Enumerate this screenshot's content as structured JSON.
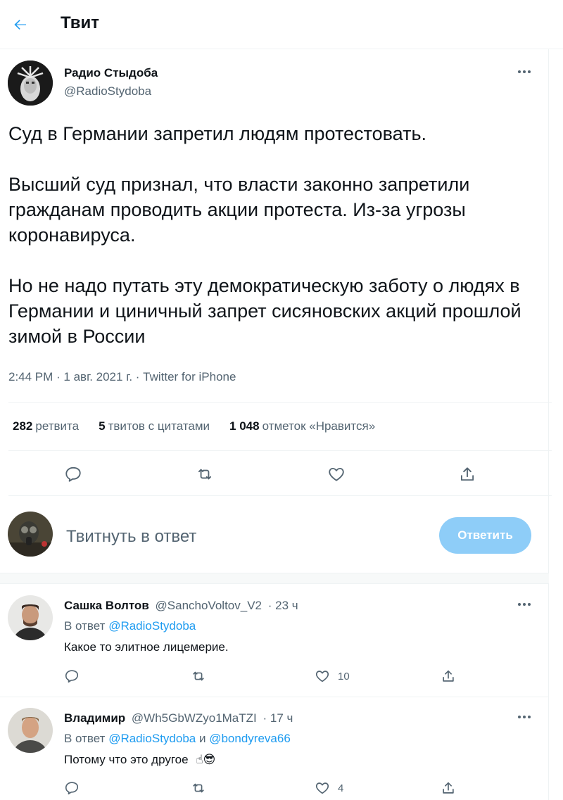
{
  "header": {
    "title": "Твит"
  },
  "tweet": {
    "author_name": "Радио Стыдоба",
    "author_handle": "@RadioStydoba",
    "paragraphs": [
      "Суд в Германии запретил людям протестовать.",
      "Высший суд признал, что власти законно запретили гражданам проводить акции протеста. Из-за угрозы коронавируса.",
      "Но не надо путать эту демократическую заботу о людях в Германии и циничный запрет сисяновских акций прошлой зимой в России"
    ],
    "meta": "2:44 PM · 1 авг. 2021 г. · Twitter for iPhone",
    "stats": {
      "retweets_count": "282",
      "retweets_label": "ретвита",
      "quotes_count": "5",
      "quotes_label": "твитов с цитатами",
      "likes_count": "1 048",
      "likes_label": "отметок «Нравится»"
    }
  },
  "reply_box": {
    "placeholder": "Твитнуть в ответ",
    "button_label": "Ответить"
  },
  "replies": [
    {
      "name": "Сашка Волтов",
      "handle": "@SanchoVoltov_V2",
      "time": "· 23 ч",
      "in_reply_prefix": "В ответ",
      "in_reply_to": "@RadioStydoba",
      "in_reply_and": "",
      "in_reply_to_2": "",
      "text": "Какое то элитное лицемерие.",
      "likes": "10"
    },
    {
      "name": "Владимир",
      "handle": "@Wh5GbWZyo1MaTZI",
      "time": "· 17 ч",
      "in_reply_prefix": "В ответ",
      "in_reply_to": "@RadioStydoba",
      "in_reply_and": "и",
      "in_reply_to_2": "@bondyreva66",
      "text": "Потому что это другое",
      "emoji": "☝😎",
      "likes": "4"
    }
  ],
  "colors": {
    "accent": "#1d9bf0",
    "muted": "#536471",
    "button_disabled": "#8ecdf8"
  }
}
